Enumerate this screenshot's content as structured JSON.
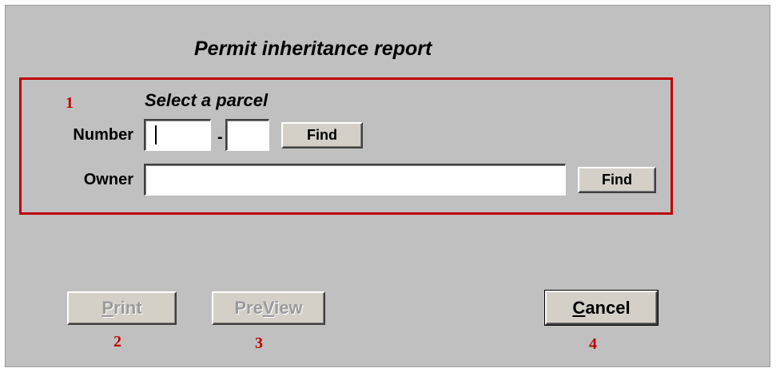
{
  "dialog": {
    "title": "Permit inheritance report"
  },
  "parcel_section": {
    "title": "Select a parcel",
    "number_label": "Number",
    "number_part1_value": "",
    "number_separator": "-",
    "number_part2_value": "",
    "number_find_label": "Find",
    "owner_label": "Owner",
    "owner_value": "",
    "owner_find_label": "Find"
  },
  "buttons": {
    "print_label": "Print",
    "print_mnemonic": "P",
    "print_enabled": false,
    "preview_label": "PreView",
    "preview_mnemonic": "V",
    "preview_enabled": false,
    "cancel_label": "Cancel",
    "cancel_mnemonic": "C",
    "cancel_enabled": true
  },
  "markers": {
    "parcel_section": "1",
    "print": "2",
    "preview": "3",
    "cancel": "4"
  },
  "colors": {
    "dialog_background": "#c0c0c0",
    "marker_color": "#c00000",
    "button_face": "#d4d0c8"
  }
}
